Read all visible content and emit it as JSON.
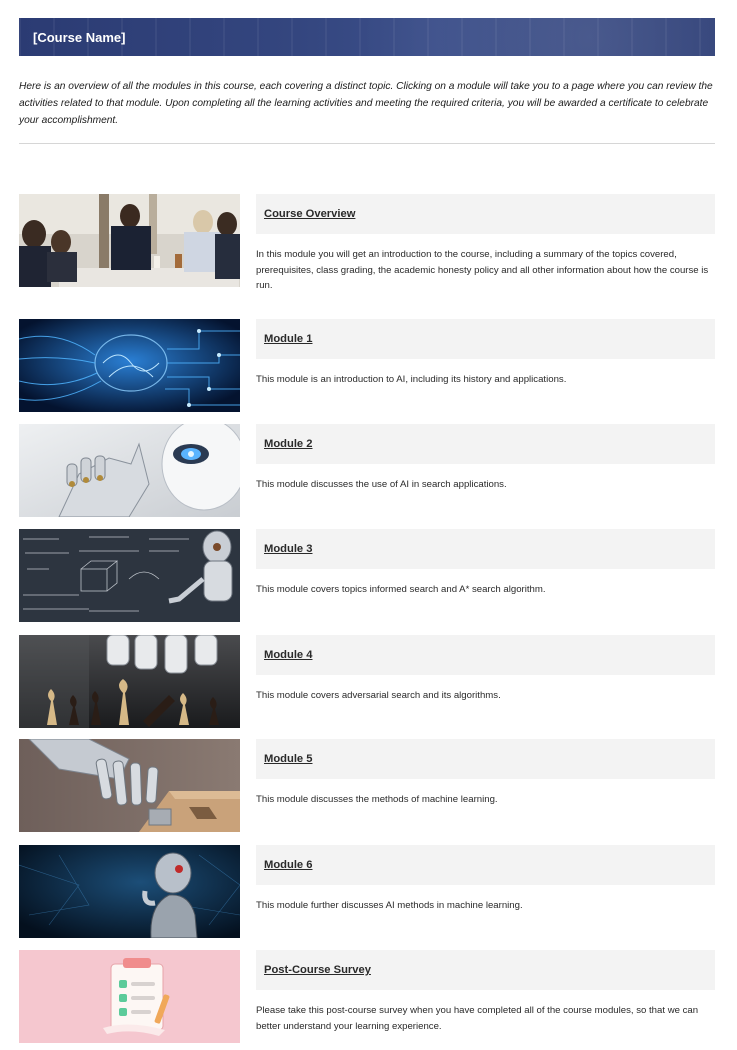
{
  "header": {
    "title": "[Course Name]"
  },
  "intro": {
    "text": "Here is an overview of all the modules in this course, each covering a distinct topic. Clicking on a module will take you to a page where you can review the activities related to that module. Upon completing all the learning activities and meeting the required criteria, you will be awarded a certificate to celebrate your accomplishment."
  },
  "modules": [
    {
      "title": "Course Overview",
      "description": "In this module you will get an introduction to the course, including a summary of the topics covered, prerequisites, class grading, the academic honesty policy and all other information about how the course is run."
    },
    {
      "title": "Module 1",
      "description": "This module is an introduction to AI, including its history and applications."
    },
    {
      "title": "Module 2",
      "description": "This module discusses the use of AI in search applications."
    },
    {
      "title": "Module 3",
      "description": "This module covers topics informed search and A* search algorithm."
    },
    {
      "title": "Module 4",
      "description": "This module covers adversarial search and its algorithms."
    },
    {
      "title": "Module 5",
      "description": "This module discusses the methods of machine learning."
    },
    {
      "title": "Module 6",
      "description": "This module further discusses AI methods in machine learning."
    },
    {
      "title": "Post-Course Survey",
      "description": "Please take this post-course survey when you have completed all of the course modules, so that we can better understand your learning experience."
    }
  ],
  "images": {
    "course_overview": "business-meeting-photo",
    "module_1": "circuit-brain-illustration",
    "module_2": "robot-thinking-photo",
    "module_3": "robot-chalkboard-math-photo",
    "module_4": "robot-hand-chess-photo",
    "module_5": "robot-hand-shape-sorter-photo",
    "module_6": "robot-thinker-dark-photo",
    "post_course_survey": "survey-checklist-illustration"
  },
  "colors": {
    "header_bg": "#2f4078",
    "title_box_bg": "#f3f3f3"
  }
}
